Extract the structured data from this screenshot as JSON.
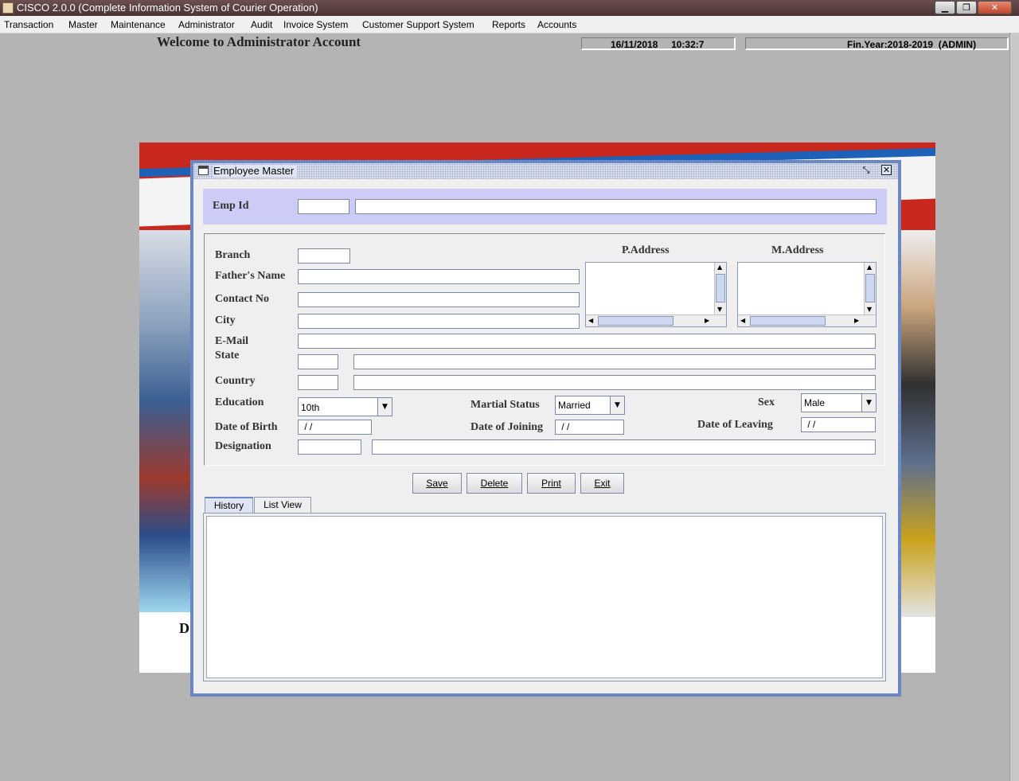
{
  "window": {
    "title": "CISCO 2.0.0 (Complete Information System of Courier Operation)"
  },
  "menubar": {
    "items": [
      "Transaction",
      "Master",
      "Maintenance",
      "Administrator",
      "Audit",
      "Invoice System",
      "Customer Support System",
      "Reports",
      "Accounts"
    ]
  },
  "header": {
    "welcome": "Welcome to Administrator Account",
    "datetime": "16/11/2018     10:32:7",
    "finyear": "Fin.Year:2018-2019  (ADMIN)"
  },
  "background": {
    "partial_text": "D"
  },
  "frame": {
    "title": "Employee Master"
  },
  "form": {
    "emp_id_label": "Emp Id",
    "branch_label": "Branch",
    "father_label": "Father's Name",
    "contact_label": "Contact No",
    "city_label": "City",
    "email_label": "E-Mail",
    "state_label": "State",
    "country_label": "Country",
    "education_label": "Education",
    "education_value": "10th",
    "marital_label": "Martial Status",
    "marital_value": "Married",
    "sex_label": "Sex",
    "sex_value": "Male",
    "dob_label": "Date of Birth",
    "dob_value": " / /",
    "doj_label": "Date of Joining",
    "doj_value": " / /",
    "dol_label": "Date of Leaving",
    "dol_value": " / /",
    "designation_label": "Designation",
    "paddress_label": "P.Address",
    "maddress_label": "M.Address"
  },
  "buttons": {
    "save": "Save",
    "delete": "Delete",
    "print": "Print",
    "exit": "Exit"
  },
  "tabs": [
    "History",
    "List View"
  ],
  "colors": {
    "frame_border": "#6b88c4",
    "emp_panel": "#ccccf7",
    "desktop": "#b4b4b4"
  }
}
